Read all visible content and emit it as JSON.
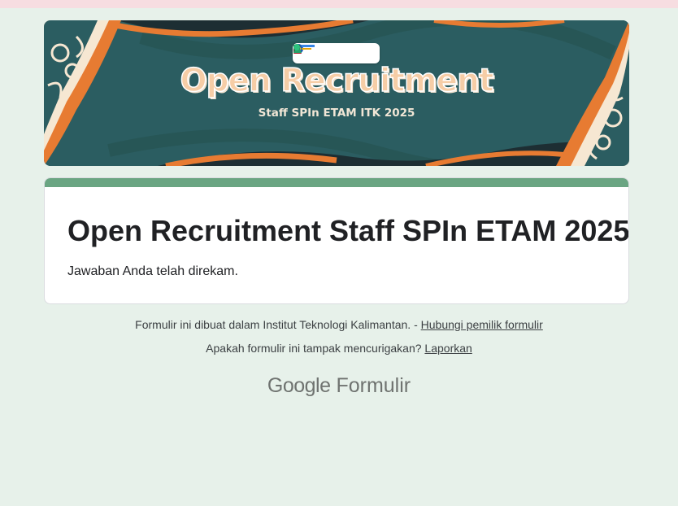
{
  "banner": {
    "title": "Open Recruitment",
    "subtitle": "Staff SPIn ETAM ITK 2025",
    "colors": {
      "teal": "#2b5d61",
      "orange": "#e77b32",
      "cream": "#f6e7d2"
    }
  },
  "form": {
    "title": "Open Recruitment Staff SPIn ETAM 2025",
    "confirmation": "Jawaban Anda telah direkam.",
    "accent_color": "#6aa582"
  },
  "footer": {
    "created_in": "Formulir ini dibuat dalam Institut Teknologi Kalimantan. -",
    "contact_link": "Hubungi pemilik formulir",
    "suspicious_text": "Apakah formulir ini tampak mencurigakan?",
    "report_link": "Laporkan",
    "brand_google": "Google",
    "brand_product": "Formulir"
  }
}
